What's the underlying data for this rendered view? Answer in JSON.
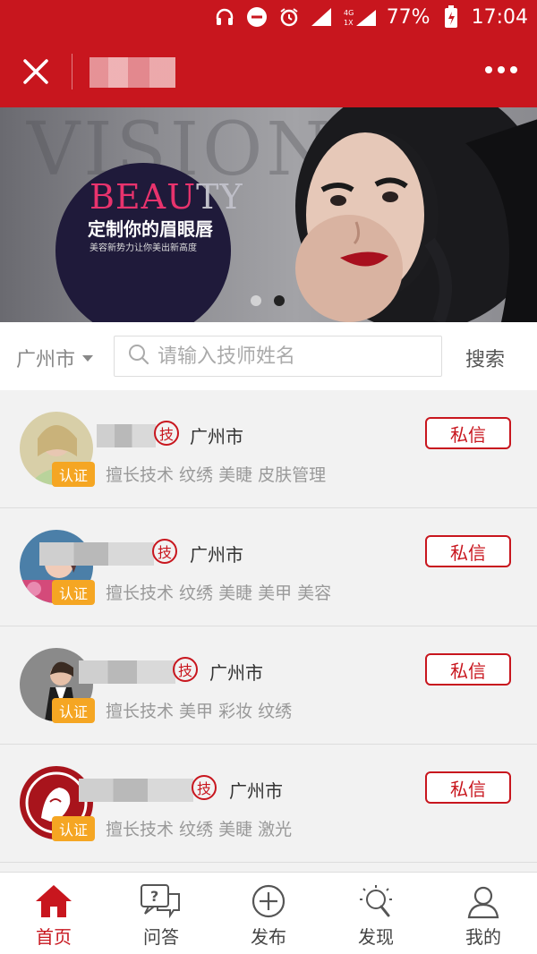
{
  "status_bar": {
    "battery": "77%",
    "time": "17:04",
    "network": "4G",
    "sim": "1X"
  },
  "navbar": {
    "close_icon": "close-icon",
    "more_icon": "more-dots-icon"
  },
  "banner": {
    "background_text": "VISION",
    "brand_a": "BEAU",
    "brand_b": "TY",
    "slogan": "定制你的眉眼唇",
    "subline": "美容新势力让你美出新高度",
    "slide_count": 2,
    "active_slide": 2
  },
  "search": {
    "city": "广州市",
    "placeholder": "请输入技师姓名",
    "value": "",
    "button": "搜索"
  },
  "technicians": [
    {
      "cert": "认证",
      "badge": "技",
      "city": "广州市",
      "skills": "擅长技术 纹绣 美睫 皮肤管理",
      "message": "私信"
    },
    {
      "cert": "认证",
      "badge": "技",
      "city": "广州市",
      "skills": "擅长技术 纹绣 美睫 美甲 美容",
      "message": "私信"
    },
    {
      "cert": "认证",
      "badge": "技",
      "city": "广州市",
      "skills": "擅长技术 美甲 彩妆 纹绣",
      "message": "私信"
    },
    {
      "cert": "认证",
      "badge": "技",
      "city": "广州市",
      "skills": "擅长技术 纹绣 美睫 激光",
      "message": "私信"
    }
  ],
  "tabs": [
    {
      "label": "首页",
      "icon": "home-icon",
      "active": true
    },
    {
      "label": "问答",
      "icon": "qa-icon",
      "active": false
    },
    {
      "label": "发布",
      "icon": "plus-circle-icon",
      "active": false
    },
    {
      "label": "发现",
      "icon": "bulb-icon",
      "active": false
    },
    {
      "label": "我的",
      "icon": "user-icon",
      "active": false
    }
  ],
  "colors": {
    "brand_red": "#c8161e",
    "cert_orange": "#f5a623"
  }
}
